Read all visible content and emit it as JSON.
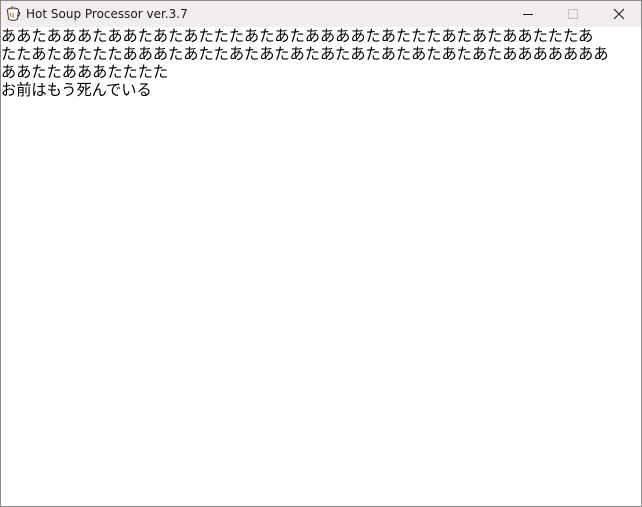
{
  "window": {
    "title": "Hot Soup Processor ver.3.7",
    "icon": "hsp-cup-icon"
  },
  "caption_buttons": {
    "minimize": "minimize-icon",
    "maximize": "maximize-icon",
    "close": "close-icon"
  },
  "content": {
    "lines": [
      "ああたあああたああたあたあたたたあたあたああああたあたたたあたあたああたたたあ",
      "たたあたあたたたあああたあたたあたあたあたあたあたあたあたあたあたあああああああ",
      "ああたたあああたたたた",
      "お前はもう死んでいる"
    ]
  },
  "colors": {
    "titlebar": "#f3eeee",
    "client_bg": "#ffffff",
    "text": "#000000",
    "border": "#8c8c8c"
  }
}
